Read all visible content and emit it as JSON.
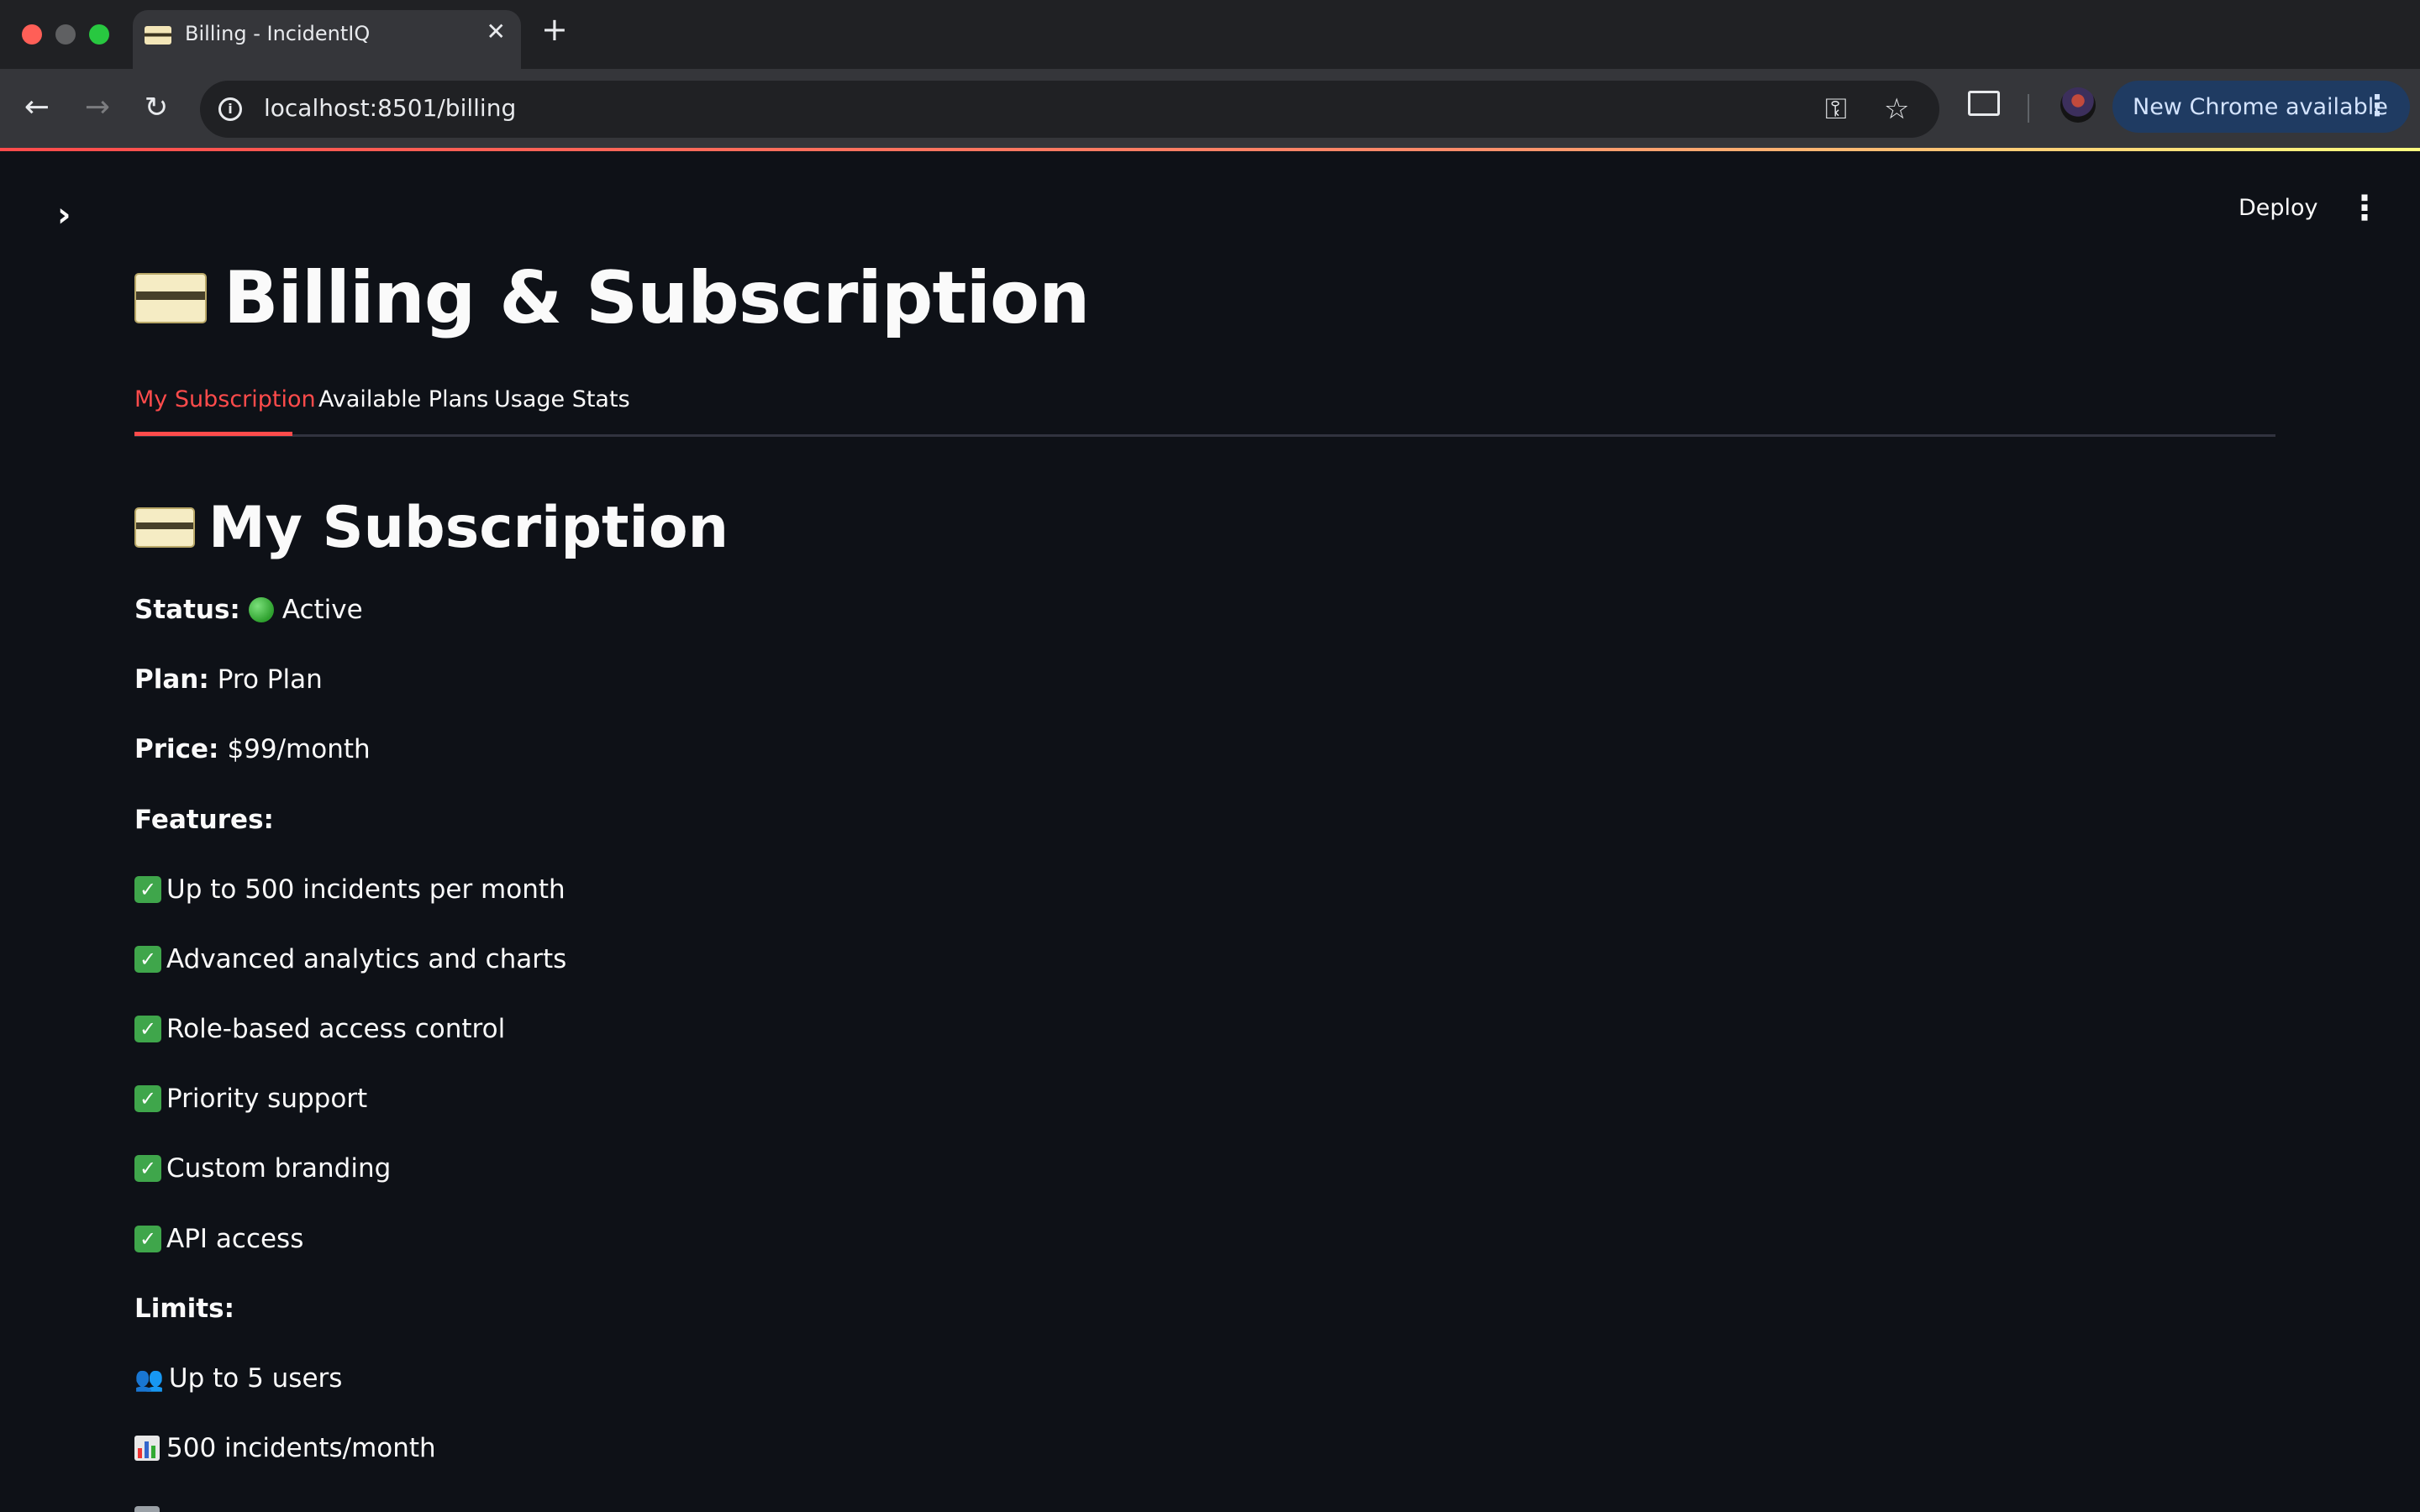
{
  "browser": {
    "tab_title": "Billing - IncidentIQ",
    "tab_close": "✕",
    "new_tab": "+",
    "url": "localhost:8501/billing",
    "update_label": "New Chrome available"
  },
  "app": {
    "deploy_label": "Deploy",
    "page_title": "Billing & Subscription",
    "tabs": [
      "My Subscription",
      "Available Plans",
      "Usage Stats"
    ],
    "active_tab": "My Subscription",
    "accent_color": "#ff4b4b"
  },
  "subscription": {
    "heading": "My Subscription",
    "status_label": "Status:",
    "status_value": "Active",
    "plan_label": "Plan:",
    "plan_value": "Pro Plan",
    "price_label": "Price:",
    "price_value": "$99/month",
    "features_label": "Features:",
    "features": [
      "Up to 500 incidents per month",
      "Advanced analytics and charts",
      "Role-based access control",
      "Priority support",
      "Custom branding",
      "API access"
    ],
    "limits_label": "Limits:",
    "limits": [
      "Up to 5 users",
      "500 incidents/month"
    ]
  }
}
